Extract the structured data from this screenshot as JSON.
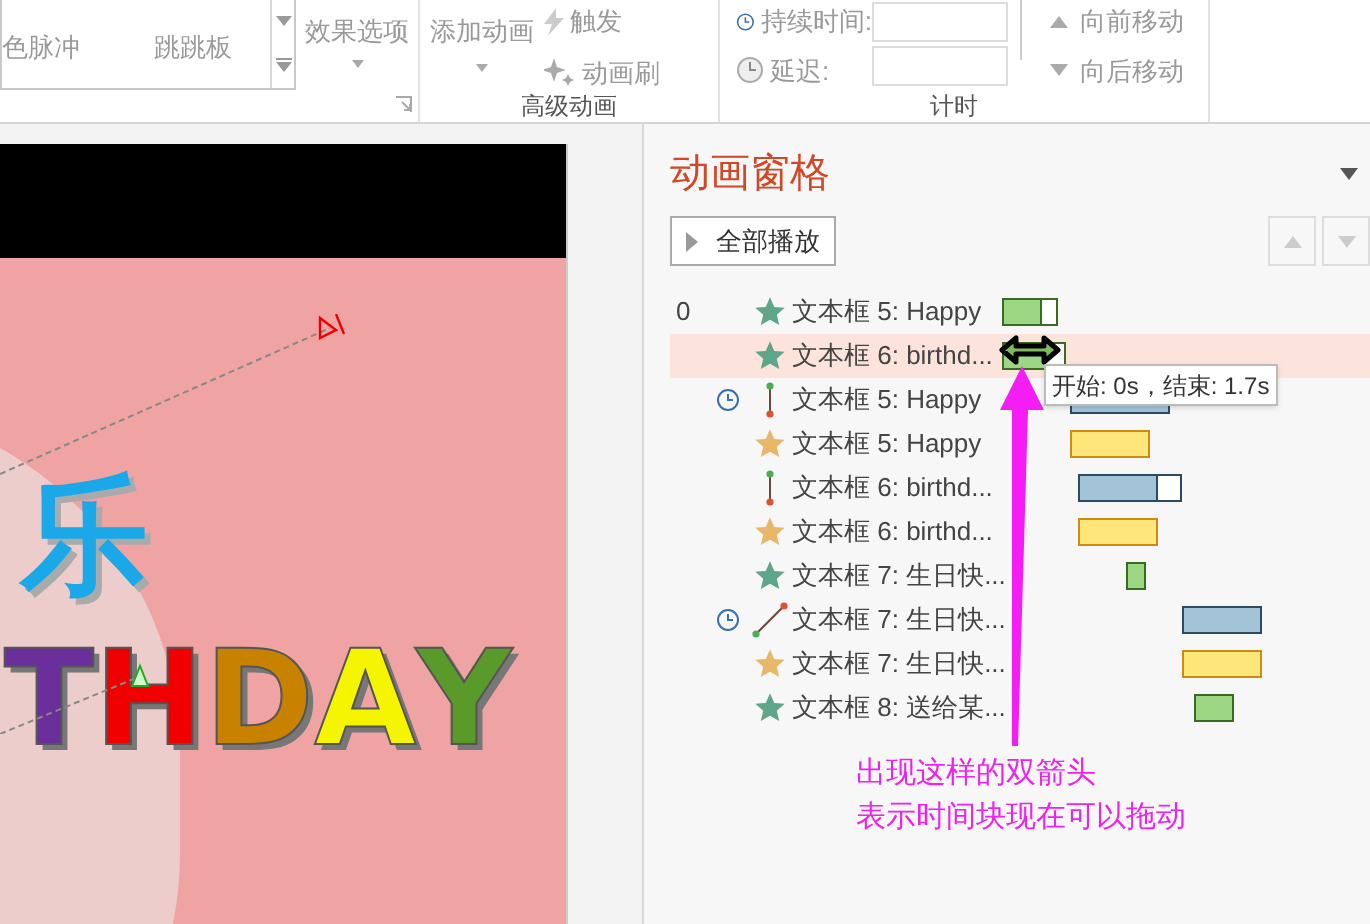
{
  "ribbon": {
    "gallery": [
      {
        "label": "色脉冲"
      },
      {
        "label": "跳跳板"
      }
    ],
    "effect_options": "效果选项",
    "add_animation": "添加动画",
    "trigger": "触发",
    "painter": "动画刷",
    "group_advanced": "高级动画",
    "duration_label": "持续时间:",
    "delay_label": "延迟:",
    "group_timing": "计时",
    "move_earlier": "向前移动",
    "move_later": "向后移动"
  },
  "slide": {
    "title_char": "乐",
    "letters": [
      {
        "text": "T",
        "color": "#6a2f9a"
      },
      {
        "text": "H",
        "color": "#f00000"
      },
      {
        "text": "D",
        "color": "#c98200"
      },
      {
        "text": "A",
        "color": "#f5f500"
      },
      {
        "text": "Y",
        "color": "#5a9a2a"
      }
    ]
  },
  "pane": {
    "title": "动画窗格",
    "play_all": "全部播放",
    "items": [
      {
        "number": "0",
        "timer": false,
        "kind": "entrance",
        "label": "文本框 5: Happy",
        "selected": false
      },
      {
        "timer": false,
        "kind": "entrance",
        "label": "文本框 6: birthd...",
        "selected": true
      },
      {
        "timer": true,
        "kind": "line-path",
        "label": "文本框 5: Happy",
        "selected": false
      },
      {
        "timer": false,
        "kind": "emphasis",
        "label": "文本框 5: Happy",
        "selected": false
      },
      {
        "timer": false,
        "kind": "line-path",
        "label": "文本框 6: birthd...",
        "selected": false
      },
      {
        "timer": false,
        "kind": "emphasis",
        "label": "文本框 6: birthd...",
        "selected": false
      },
      {
        "timer": false,
        "kind": "entrance",
        "label": "文本框 7: 生日快...",
        "selected": false
      },
      {
        "timer": true,
        "kind": "diagonal-path",
        "label": "文本框 7: 生日快...",
        "selected": false
      },
      {
        "timer": false,
        "kind": "emphasis",
        "label": "文本框 7: 生日快...",
        "selected": false
      },
      {
        "timer": false,
        "kind": "entrance",
        "label": "文本框 8: 送给某...",
        "selected": false
      }
    ],
    "tooltip": "开始: 0s，结束: 1.7s"
  },
  "annotation": {
    "lines": [
      "出现这样的双箭头",
      "表示时间块现在可以拖动"
    ]
  }
}
